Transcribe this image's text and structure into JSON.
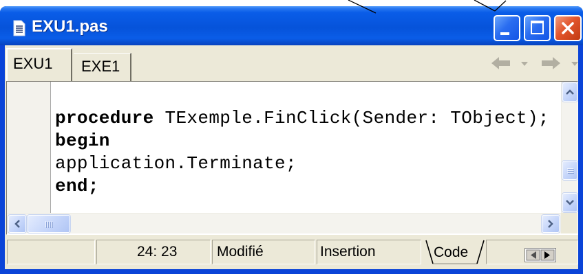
{
  "window": {
    "title": "EXU1.pas",
    "icon": "document-icon"
  },
  "title_buttons": {
    "minimize": "minimize-icon",
    "maximize": "maximize-icon",
    "close": "close-icon"
  },
  "tabs": [
    {
      "label": "EXU1",
      "selected": true
    },
    {
      "label": "EXE1",
      "selected": false
    }
  ],
  "navigation": {
    "back": "back-arrow-icon",
    "back_menu": "chevron-down-icon",
    "forward": "forward-arrow-icon",
    "forward_menu": "chevron-down-icon",
    "enabled": false
  },
  "editor": {
    "lines": [
      {
        "keyword": "procedure",
        "text": " TExemple.FinClick(Sender: TObject);"
      },
      {
        "keyword": "begin"
      },
      {
        "text": "application.Terminate;"
      },
      {
        "keyword": "end;"
      }
    ]
  },
  "scrollbars": {
    "vertical_position": 0.83,
    "horizontal_position": 0.0
  },
  "status": {
    "cursor_position": "24: 23",
    "modified": "Modifié",
    "insert_mode": "Insertion",
    "view_tab": "Code",
    "view_toggle_icon": "form-code-toggle-icon"
  },
  "colors": {
    "title_bar": "#0A5DE8",
    "window_frame": "#0A44D8",
    "close_button": "#E2552C",
    "face": "#ECE9D8",
    "disabled_glyph": "#B2AFA2",
    "scroll_accent": "#4D6185"
  }
}
